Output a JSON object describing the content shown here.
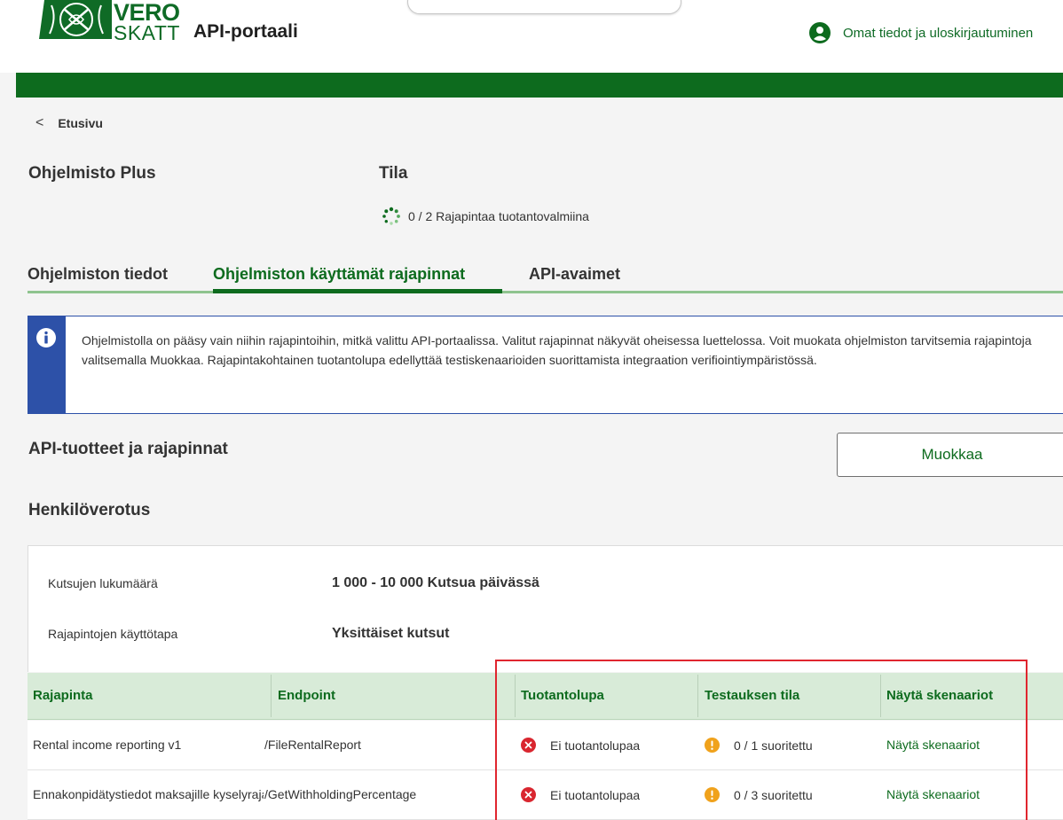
{
  "header": {
    "logo_line1": "VERO",
    "logo_line2": "SKATT",
    "portal_title": "API-portaali",
    "user_link": "Omat tiedot ja uloskirjautuminen"
  },
  "breadcrumb": {
    "back_label": "Etusivu"
  },
  "software": {
    "name": "Ohjelmisto Plus",
    "status_label": "Tila",
    "status_text": "0 / 2 Rajapintaa tuotantovalmiina"
  },
  "tabs": [
    {
      "label": "Ohjelmiston tiedot"
    },
    {
      "label": "Ohjelmiston käyttämät rajapinnat"
    },
    {
      "label": "API-avaimet"
    }
  ],
  "info": {
    "text": "Ohjelmistolla on pääsy vain niihin rajapintoihin, mitkä valittu API-portaalissa. Valitut rajapinnat näkyvät oheisessa luettelossa. Voit muokata ohjelmiston tarvitsemia rajapintoja valitsemalla Muokkaa. Rajapintakohtainen tuotantolupa edellyttää testiskenaarioiden suorittamista integraation verifiointiympäristössä."
  },
  "section": {
    "title": "API-tuotteet ja rajapinnat",
    "edit_label": "Muokkaa",
    "subsection_title": "Henkilöverotus"
  },
  "details": {
    "calls_label": "Kutsujen lukumäärä",
    "calls_value": "1 000 - 10 000 Kutsua päivässä",
    "usage_label": "Rajapintojen käyttötapa",
    "usage_value": "Yksittäiset kutsut"
  },
  "table": {
    "headers": [
      "Rajapinta",
      "Endpoint",
      "Tuotantolupa",
      "Testauksen tila",
      "Näytä skenaariot"
    ],
    "rows": [
      {
        "api": "Rental income reporting v1",
        "endpoint": "/FileRentalReport",
        "permit": "Ei tuotantolupaa",
        "test_status": "0 / 1 suoritettu",
        "link": "Näytä skenaariot"
      },
      {
        "api": "Ennakonpidätystiedot maksajille kyselyrajapinta",
        "endpoint": "/GetWithholdingPercentage",
        "permit": "Ei tuotantolupaa",
        "test_status": "0 / 3 suoritettu",
        "link": "Näytä skenaariot"
      }
    ]
  },
  "colors": {
    "brand_green": "#0d6b1e",
    "info_blue": "#2d51a8",
    "error_red": "#d9262f",
    "warning_orange": "#f0a21c",
    "highlight_red": "#e0262f"
  }
}
